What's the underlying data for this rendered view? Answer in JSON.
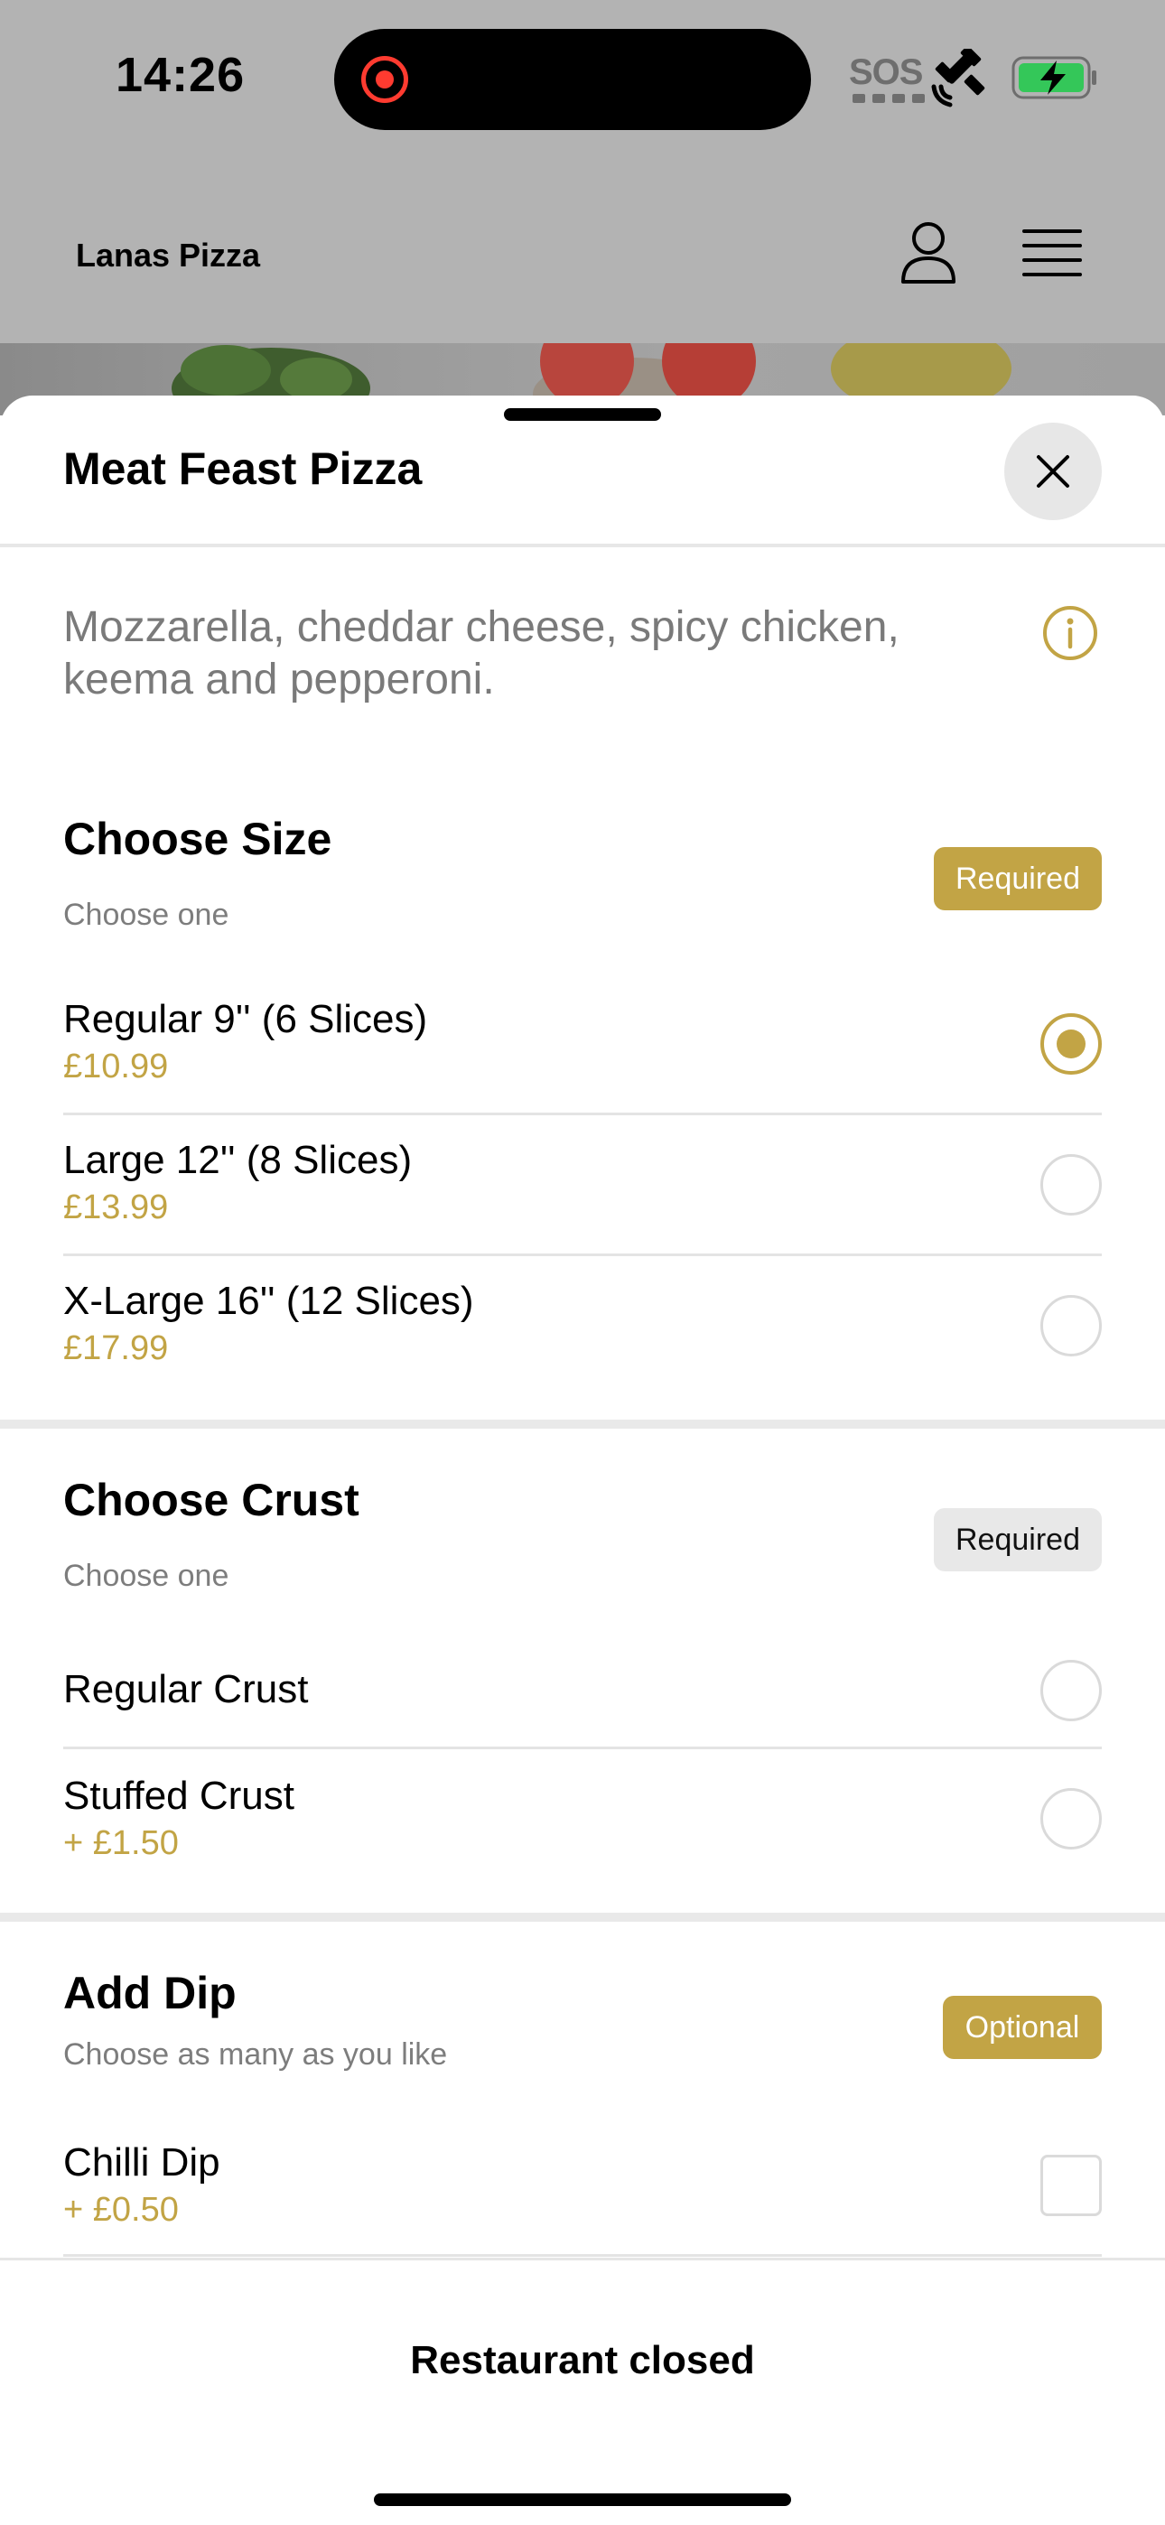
{
  "status_bar": {
    "time": "14:26",
    "sos_label": "SOS"
  },
  "header": {
    "brand": "Lanas Pizza"
  },
  "sheet": {
    "title": "Meat Feast Pizza",
    "description": "Mozzarella, cheddar cheese, spicy chicken, keema and pepperoni."
  },
  "sections": {
    "size": {
      "title": "Choose Size",
      "subtitle": "Choose one",
      "badge": "Required",
      "options": [
        {
          "name": "Regular 9'' (6 Slices)",
          "price": "£10.99",
          "selected": true
        },
        {
          "name": "Large 12'' (8 Slices)",
          "price": "£13.99",
          "selected": false
        },
        {
          "name": "X-Large 16'' (12 Slices)",
          "price": "£17.99",
          "selected": false
        }
      ]
    },
    "crust": {
      "title": "Choose Crust",
      "subtitle": "Choose one",
      "badge": "Required",
      "options": [
        {
          "name": "Regular Crust",
          "price": "",
          "selected": false
        },
        {
          "name": "Stuffed Crust",
          "price": "+ £1.50",
          "selected": false
        }
      ]
    },
    "dip": {
      "title": "Add Dip",
      "subtitle": "Choose as many as you like",
      "badge": "Optional",
      "options": [
        {
          "name": "Chilli Dip",
          "price": "+ £0.50",
          "checked": false
        }
      ]
    }
  },
  "footer": {
    "status": "Restaurant closed"
  },
  "colors": {
    "accent": "#c2a445",
    "badge_grey": "#e8e8e8",
    "dim_overlay": "#b3b3b3"
  },
  "icons": [
    "record-icon",
    "satellite-icon",
    "battery-charging-icon",
    "user-icon",
    "menu-icon",
    "close-icon",
    "info-icon"
  ]
}
